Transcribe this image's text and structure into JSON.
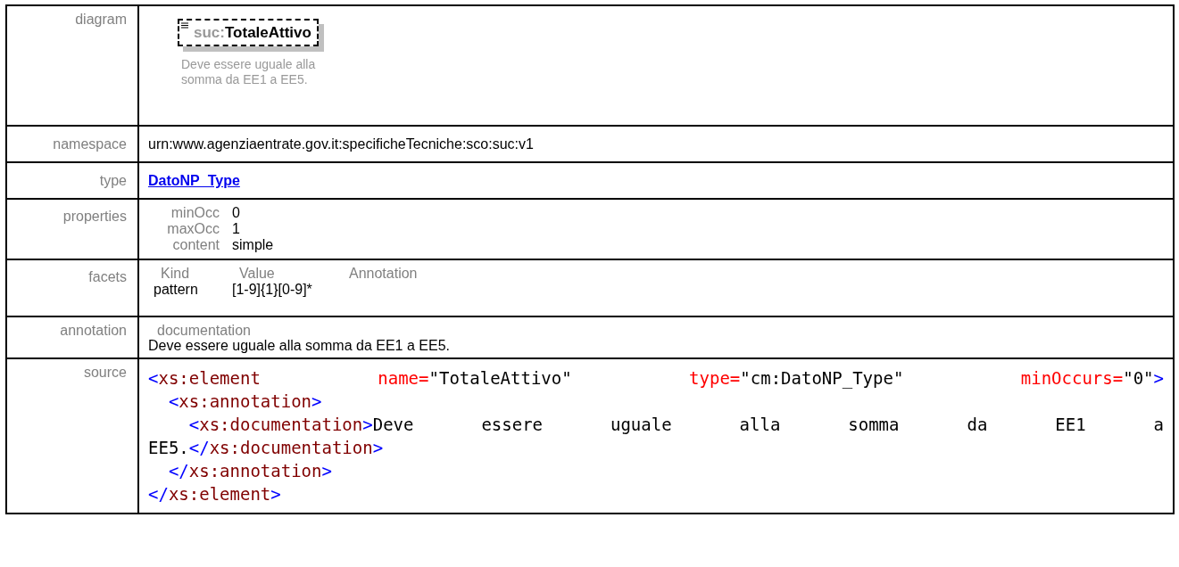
{
  "sections": [
    {
      "label": "diagram",
      "kind": "diagram",
      "element": {
        "prefix": "suc:",
        "name": "TotaleAttivo"
      },
      "caption": [
        "Deve essere uguale alla",
        "somma da EE1 a EE5."
      ]
    },
    {
      "label": "namespace",
      "kind": "text",
      "value": "urn:www.agenziaentrate.gov.it:specificheTecniche:sco:suc:v1"
    },
    {
      "label": "type",
      "kind": "link",
      "value": "DatoNP_Type"
    },
    {
      "label": "properties",
      "kind": "pairs",
      "pairs": [
        {
          "key": "minOcc",
          "value": "0"
        },
        {
          "key": "maxOcc",
          "value": "1"
        },
        {
          "key": "content",
          "value": "simple"
        }
      ]
    },
    {
      "label": "facets",
      "kind": "table",
      "facet_table": {
        "columns": [
          "Kind",
          "Value",
          "Annotation"
        ],
        "rows": [
          [
            "pattern",
            "[1-9]{1}[0-9]*"
          ]
        ]
      }
    },
    {
      "label": "annotation",
      "kind": "doc",
      "heading": "documentation",
      "value": "Deve essere uguale alla somma da EE1 a EE5."
    },
    {
      "label": "source",
      "kind": "source",
      "nodes": [
        {
          "kind": "spread",
          "tokens": [
            {
              "kind": "punct",
              "s": "<"
            },
            {
              "kind": "tag",
              "s": "xs:element"
            },
            {
              "kind": "attr",
              "s": "name="
            },
            {
              "kind": "value",
              "s": "\"TotaleAttivo\""
            },
            {
              "kind": "attr",
              "s": "type="
            },
            {
              "kind": "value",
              "s": "\"cm:DatoNP_Type\""
            },
            {
              "kind": "attr",
              "s": "minOccurs="
            },
            {
              "kind": "value",
              "s": "\"0\""
            },
            {
              "kind": "punct",
              "s": ">"
            }
          ],
          "children": [
            {
              "tokens": [
                {
                  "kind": "punct",
                  "s": "<"
                },
                {
                  "kind": "tag",
                  "s": "xs:annotation"
                },
                {
                  "kind": "punct",
                  "s": ">"
                }
              ],
              "children": [
                {
                  "kind": "spread",
                  "tokens": [
                    {
                      "kind": "punct",
                      "s": "<"
                    },
                    {
                      "kind": "tag",
                      "s": "xs:documentation"
                    },
                    {
                      "kind": "punct",
                      "s": ">"
                    },
                    {
                      "kind": "text",
                      "s": "Deve essere uguale alla somma da EE1 a"
                    }
                  ],
                  "wrap": [
                    {
                      "kind": "text",
                      "s": "EE5."
                    },
                    {
                      "kind": "punct",
                      "s": "</"
                    },
                    {
                      "kind": "tag",
                      "s": "xs:documentation"
                    },
                    {
                      "kind": "punct",
                      "s": ">"
                    }
                  ]
                }
              ],
              "close": [
                {
                  "kind": "punct",
                  "s": "</"
                },
                {
                  "kind": "tag",
                  "s": "xs:annotation"
                },
                {
                  "kind": "punct",
                  "s": ">"
                }
              ]
            }
          ],
          "close": [
            {
              "kind": "punct",
              "s": "</"
            },
            {
              "kind": "tag",
              "s": "xs:element"
            },
            {
              "kind": "punct",
              "s": ">"
            }
          ]
        }
      ]
    }
  ]
}
